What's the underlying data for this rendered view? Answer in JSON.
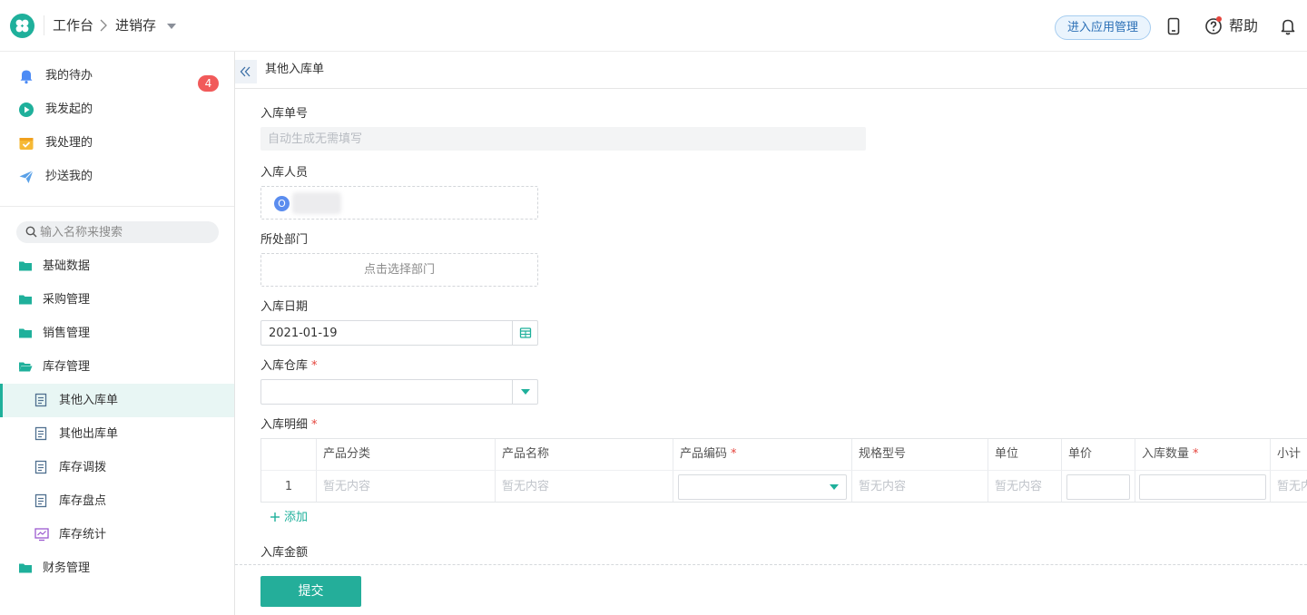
{
  "header": {
    "breadcrumb": [
      "工作台",
      "进销存"
    ],
    "app_manage_label": "进入应用管理",
    "help_label": "帮助",
    "brand_color": "#1fb09b"
  },
  "sidebar": {
    "todo": {
      "label": "我的待办",
      "badge": "4"
    },
    "items": [
      {
        "label": "我发起的",
        "icon": "play-circle-icon"
      },
      {
        "label": "我处理的",
        "icon": "inbox-icon"
      },
      {
        "label": "抄送我的",
        "icon": "paper-plane-icon"
      }
    ],
    "search_placeholder": "输入名称来搜索",
    "folders": [
      {
        "label": "基础数据",
        "icon": "folder-icon"
      },
      {
        "label": "采购管理",
        "icon": "folder-icon"
      },
      {
        "label": "销售管理",
        "icon": "folder-icon"
      },
      {
        "label": "库存管理",
        "icon": "folder-open-icon"
      }
    ],
    "inventory_children": [
      {
        "label": "其他入库单",
        "icon": "document-icon",
        "active": true
      },
      {
        "label": "其他出库单",
        "icon": "document-icon"
      },
      {
        "label": "库存调拨",
        "icon": "document-icon"
      },
      {
        "label": "库存盘点",
        "icon": "document-icon"
      },
      {
        "label": "库存统计",
        "icon": "monitor-chart-icon"
      }
    ],
    "last_folder": {
      "label": "财务管理",
      "icon": "folder-icon"
    }
  },
  "main": {
    "page_title": "其他入库单",
    "fields": {
      "receipt_no": {
        "label": "入库单号",
        "placeholder": "自动生成无需填写"
      },
      "staff": {
        "label": "入库人员",
        "avatar_letter": "O"
      },
      "department": {
        "label": "所处部门",
        "hint": "点击选择部门"
      },
      "date": {
        "label": "入库日期",
        "value": "2021-01-19"
      },
      "warehouse": {
        "label": "入库仓库",
        "required_mark": "*"
      },
      "details": {
        "label": "入库明细",
        "required_mark": "*"
      },
      "amount": {
        "label": "入库金额"
      }
    },
    "table": {
      "columns": [
        {
          "label": "产品分类",
          "required": ""
        },
        {
          "label": "产品名称",
          "required": ""
        },
        {
          "label": "产品编码",
          "required": "*"
        },
        {
          "label": "规格型号",
          "required": ""
        },
        {
          "label": "单位",
          "required": ""
        },
        {
          "label": "单价",
          "required": ""
        },
        {
          "label": "入库数量",
          "required": "*"
        },
        {
          "label": "小计",
          "required": ""
        }
      ],
      "row": {
        "index": "1",
        "empty_text": "暂无内容"
      }
    },
    "add_label": "添加",
    "submit_label": "提交"
  }
}
